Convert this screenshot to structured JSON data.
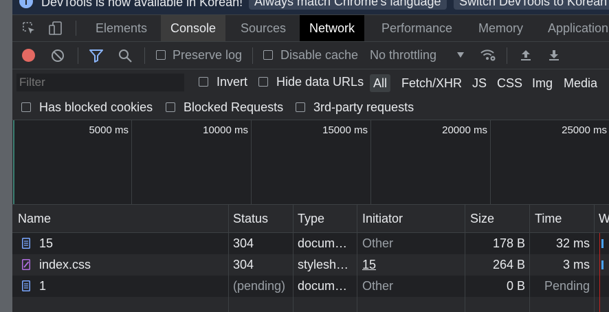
{
  "infobar": {
    "message": "DevTools is now available in Korean!",
    "button_match": "Always match Chrome's language",
    "button_switch": "Switch DevTools to Korean"
  },
  "tabs": [
    {
      "label": "Elements"
    },
    {
      "label": "Console"
    },
    {
      "label": "Sources"
    },
    {
      "label": "Network"
    },
    {
      "label": "Performance"
    },
    {
      "label": "Memory"
    },
    {
      "label": "Application"
    }
  ],
  "toolbar": {
    "preserve_log": "Preserve log",
    "disable_cache": "Disable cache",
    "throttling": "No throttling"
  },
  "filter": {
    "placeholder": "Filter",
    "invert": "Invert",
    "hide_data_urls": "Hide data URLs",
    "types": [
      "All",
      "Fetch/XHR",
      "JS",
      "CSS",
      "Img",
      "Media"
    ]
  },
  "blocked": {
    "has_blocked_cookies": "Has blocked cookies",
    "blocked_requests": "Blocked Requests",
    "third_party": "3rd-party requests"
  },
  "overview": {
    "ticks": [
      "5000 ms",
      "10000 ms",
      "15000 ms",
      "20000 ms",
      "25000 ms"
    ]
  },
  "table": {
    "headers": [
      "Name",
      "Status",
      "Type",
      "Initiator",
      "Size",
      "Time",
      "W"
    ],
    "rows": [
      {
        "name": "15",
        "status": "304",
        "type": "docum…",
        "initiator": "Other",
        "size": "178 B",
        "time": "32 ms",
        "icon": "document-icon"
      },
      {
        "name": "index.css",
        "status": "304",
        "type": "stylesh…",
        "initiator": "15",
        "size": "264 B",
        "time": "3 ms",
        "icon": "stylesheet-icon"
      },
      {
        "name": "1",
        "status": "(pending)",
        "type": "docum…",
        "initiator": "Other",
        "size": "0 B",
        "time": "Pending",
        "icon": "document-icon"
      }
    ]
  },
  "colors": {
    "record": "#e46962",
    "filter_active": "#8ab4f8",
    "document_icon": "#7aa7ff",
    "stylesheet_icon": "#b06ee0",
    "waterfall_bar": "#4aa3f7",
    "waterfall_marker": "#c5221f"
  }
}
